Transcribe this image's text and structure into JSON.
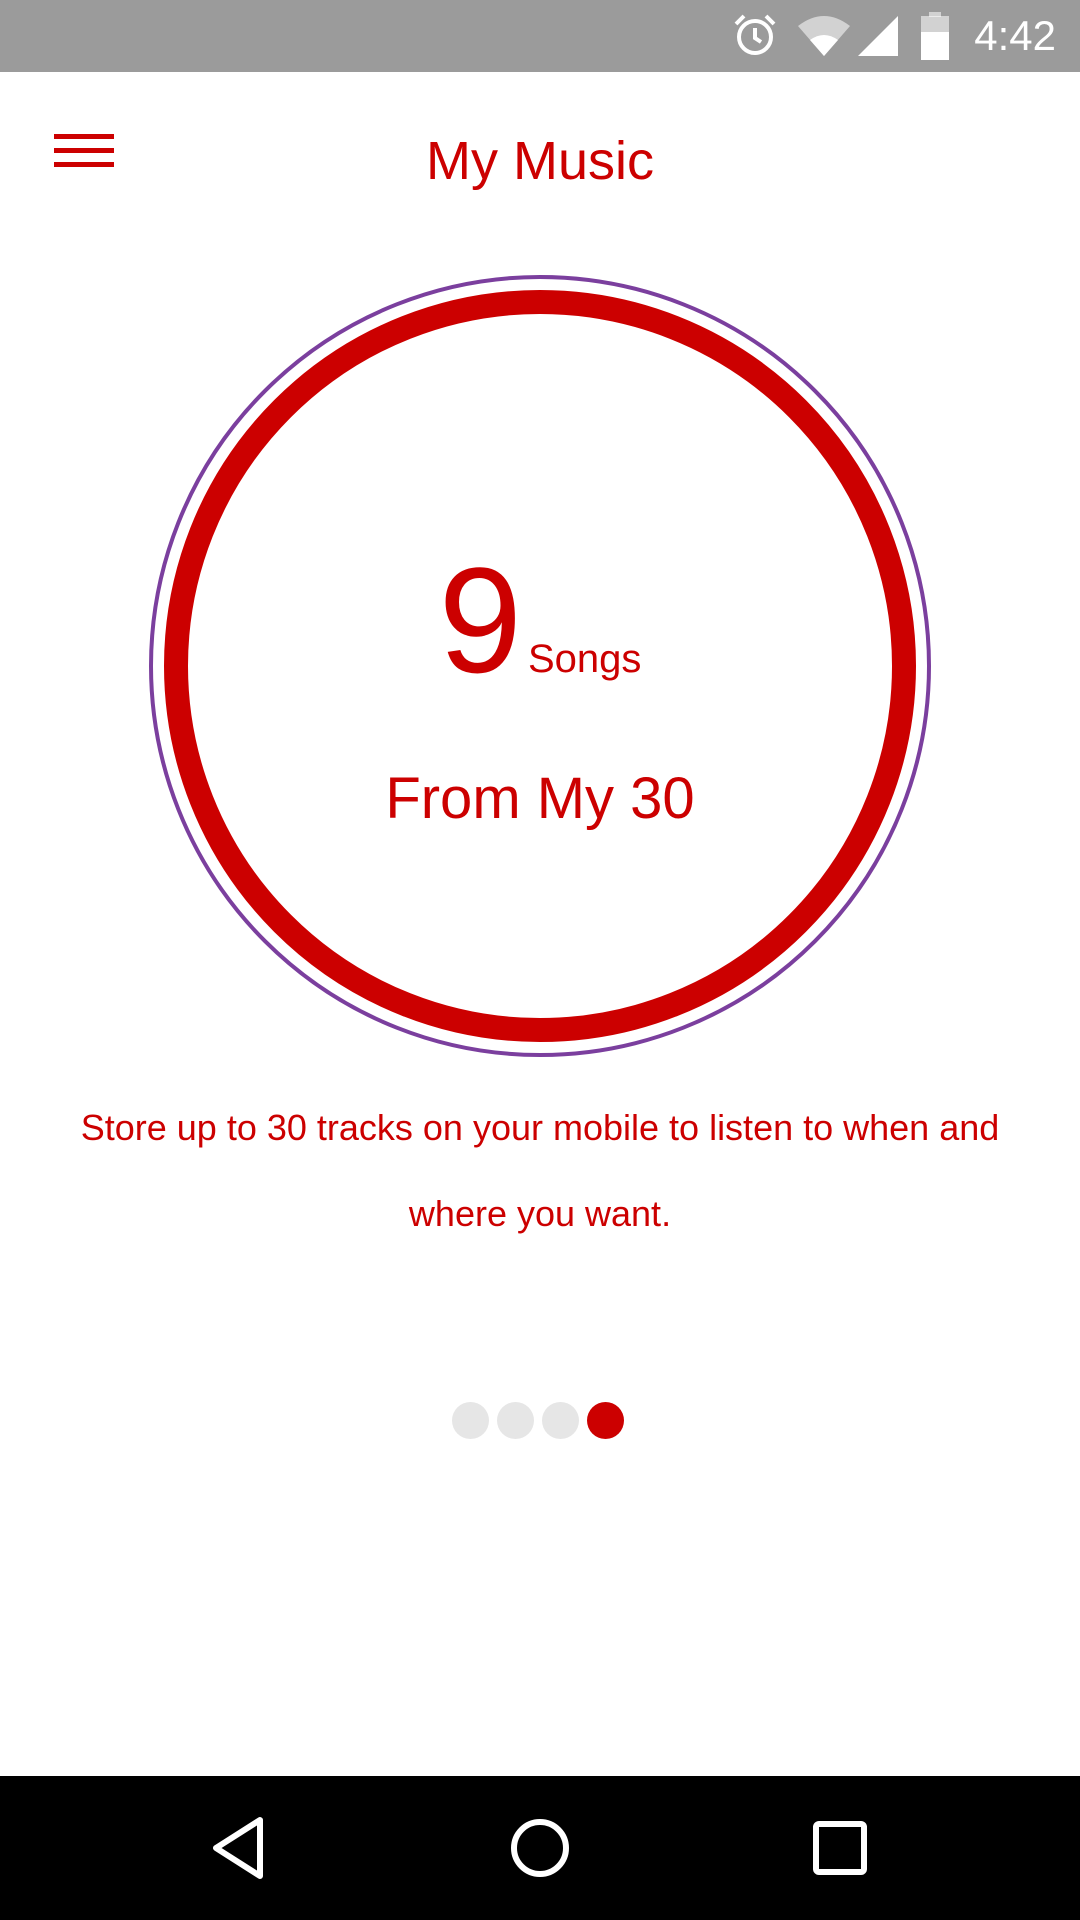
{
  "status_bar": {
    "time": "4:42",
    "icons": [
      "alarm-icon",
      "wifi-icon",
      "signal-icon",
      "battery-icon"
    ]
  },
  "header": {
    "title": "My Music",
    "menu_icon": "hamburger-menu-icon"
  },
  "summary": {
    "count": "9",
    "unit": "Songs",
    "subtitle": "From My 30",
    "description": "Store up to 30 tracks on your mobile to listen to when and where you want."
  },
  "pager": {
    "total_pages": 4,
    "active_page": 4
  },
  "nav_bar": {
    "icons": [
      "back-icon",
      "home-icon",
      "recents-icon"
    ]
  },
  "colors": {
    "accent": "#cc0000",
    "ring_outline": "#7b3f9e",
    "status_bar": "#9b9b9b",
    "dot_inactive": "#e6e6e6"
  }
}
